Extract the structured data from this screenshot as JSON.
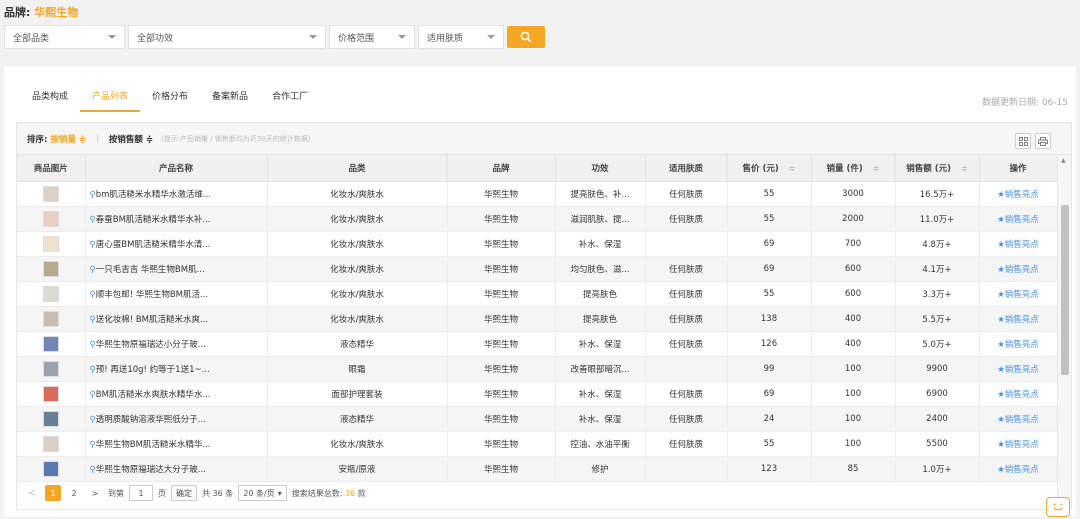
{
  "brand": {
    "label": "品牌:",
    "value": "华熙生物"
  },
  "filters": {
    "category": "全部品类",
    "effect": "全部功效",
    "price": "价格范围",
    "skin": "适用肤质"
  },
  "tabs": [
    "品类构成",
    "产品列表",
    "价格分布",
    "备案新品",
    "合作工厂"
  ],
  "active_tab": 1,
  "update_date": "数据更新日期: 06-15",
  "sort_bar": {
    "label": "排序:",
    "active": "按销量 ≑",
    "option": "按销售额 ≑",
    "tip": "(提示:产品销量 / 销售额均为近30天的统计数据)"
  },
  "columns": [
    "商品图片",
    "产品名称",
    "品类",
    "品牌",
    "功效",
    "适用肤质",
    "售价 (元)",
    "销量 (件)",
    "销售额 (元)",
    "操作"
  ],
  "rows": [
    {
      "name": "bm肌活糙米水精华水激活维...",
      "category": "化妆水/爽肤水",
      "brand": "华熙生物",
      "effect": "提亮肤色、补...",
      "skin": "任何肤质",
      "price": "55",
      "sales": "3000",
      "revenue": "16.5万+",
      "action": "★销售亮点",
      "thumb": "#d9d2c5"
    },
    {
      "name": "春蚕BM肌活糙米水精华水补...",
      "category": "化妆水/爽肤水",
      "brand": "华熙生物",
      "effect": "滋润肌肤、提...",
      "skin": "任何肤质",
      "price": "55",
      "sales": "2000",
      "revenue": "11.0万+",
      "action": "★销售亮点",
      "thumb": "#e8cfc4"
    },
    {
      "name": "唐心蛋BM肌活糙米精华水清...",
      "category": "化妆水/爽肤水",
      "brand": "华熙生物",
      "effect": "补水、保湿",
      "skin": "",
      "price": "69",
      "sales": "700",
      "revenue": "4.8万+",
      "action": "★销售亮点",
      "thumb": "#efe3cf"
    },
    {
      "name": "一只毛吉吉 华熙生物BM肌...",
      "category": "化妆水/爽肤水",
      "brand": "华熙生物",
      "effect": "均匀肤色、滋...",
      "skin": "任何肤质",
      "price": "69",
      "sales": "600",
      "revenue": "4.1万+",
      "action": "★销售亮点",
      "thumb": "#b8a98e"
    },
    {
      "name": "顺丰包邮! 华熙生物BM肌活...",
      "category": "化妆水/爽肤水",
      "brand": "华熙生物",
      "effect": "提亮肤色",
      "skin": "任何肤质",
      "price": "55",
      "sales": "600",
      "revenue": "3.3万+",
      "action": "★销售亮点",
      "thumb": "#dcdad2"
    },
    {
      "name": "送化妆棉! BM肌活糙米水爽...",
      "category": "化妆水/爽肤水",
      "brand": "华熙生物",
      "effect": "提亮肤色",
      "skin": "任何肤质",
      "price": "138",
      "sales": "400",
      "revenue": "5.5万+",
      "action": "★销售亮点",
      "thumb": "#c9bdb0"
    },
    {
      "name": "华熙生物原福瑞达小分子玻...",
      "category": "液态精华",
      "brand": "华熙生物",
      "effect": "补水、保湿",
      "skin": "任何肤质",
      "price": "126",
      "sales": "400",
      "revenue": "5.0万+",
      "action": "★销售亮点",
      "thumb": "#6f88b8"
    },
    {
      "name": "预! 再送10g! 约等于1送1~...",
      "category": "眼霜",
      "brand": "华熙生物",
      "effect": "改善眼部暗沉...",
      "skin": "",
      "price": "99",
      "sales": "100",
      "revenue": "9900",
      "action": "★销售亮点",
      "thumb": "#9aa3ad"
    },
    {
      "name": "BM肌活糙米水爽肤水精华水...",
      "category": "面部护理套装",
      "brand": "华熙生物",
      "effect": "补水、保湿",
      "skin": "任何肤质",
      "price": "69",
      "sales": "100",
      "revenue": "6900",
      "action": "★销售亮点",
      "thumb": "#d86b5c"
    },
    {
      "name": "透明质酸钠溶液华熙低分子...",
      "category": "液态精华",
      "brand": "华熙生物",
      "effect": "补水、保湿",
      "skin": "任何肤质",
      "price": "24",
      "sales": "100",
      "revenue": "2400",
      "action": "★销售亮点",
      "thumb": "#6a7f95"
    },
    {
      "name": "华熙生物BM肌活糙米水精华...",
      "category": "化妆水/爽肤水",
      "brand": "华熙生物",
      "effect": "控油、水油平衡",
      "skin": "任何肤质",
      "price": "55",
      "sales": "100",
      "revenue": "5500",
      "action": "★销售亮点",
      "thumb": "#d9cfc2"
    },
    {
      "name": "华熙生物原福瑞达大分子玻...",
      "category": "安瓶/原液",
      "brand": "华熙生物",
      "effect": "修护",
      "skin": "",
      "price": "123",
      "sales": "85",
      "revenue": "1.0万+",
      "action": "★销售亮点",
      "thumb": "#5b79b0"
    }
  ],
  "pager": {
    "prev": "<",
    "pages": [
      "1",
      "2"
    ],
    "next": ">",
    "goto_label": "到第",
    "goto_value": "1",
    "page_unit": "页",
    "confirm": "确定",
    "total": "共 36 条",
    "size": "20 条/页",
    "result_label": "搜索结果总数:",
    "result_count": "36",
    "result_unit": "款"
  },
  "colors": {
    "accent": "#f5a623",
    "link": "#4a90e2"
  }
}
